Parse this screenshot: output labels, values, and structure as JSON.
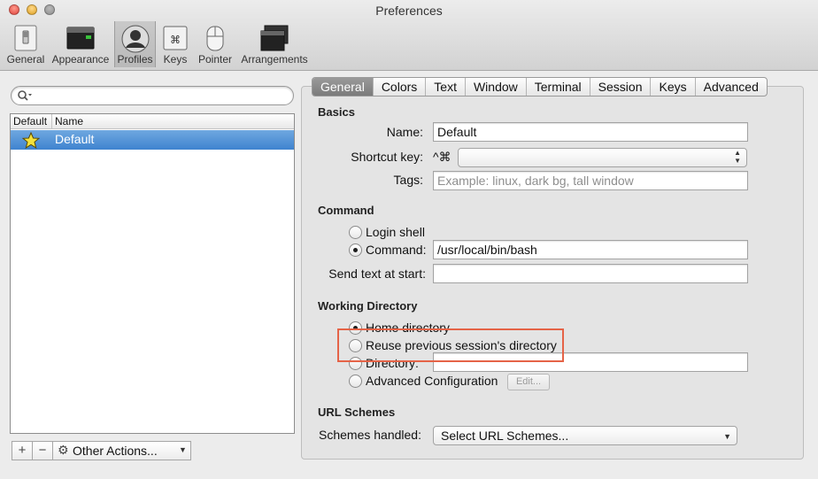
{
  "window": {
    "title": "Preferences"
  },
  "toolbar": {
    "items": [
      {
        "label": "General",
        "icon": "general-switch-icon"
      },
      {
        "label": "Appearance",
        "icon": "appearance-screen-icon"
      },
      {
        "label": "Profiles",
        "icon": "profile-person-icon",
        "selected": true
      },
      {
        "label": "Keys",
        "icon": "command-key-icon"
      },
      {
        "label": "Pointer",
        "icon": "mouse-pointer-icon"
      },
      {
        "label": "Arrangements",
        "icon": "window-arrangements-icon"
      }
    ]
  },
  "left": {
    "search_placeholder": "",
    "columns": {
      "default": "Default",
      "name": "Name"
    },
    "profiles": [
      {
        "name": "Default",
        "is_default": true,
        "selected": true
      }
    ],
    "add_label": "+",
    "remove_label": "−",
    "other_actions_label": "Other Actions..."
  },
  "tabs": [
    {
      "label": "General",
      "selected": true
    },
    {
      "label": "Colors"
    },
    {
      "label": "Text"
    },
    {
      "label": "Window"
    },
    {
      "label": "Terminal"
    },
    {
      "label": "Session"
    },
    {
      "label": "Keys"
    },
    {
      "label": "Advanced"
    }
  ],
  "basics": {
    "heading": "Basics",
    "name_label": "Name:",
    "name_value": "Default",
    "shortcut_label": "Shortcut key:",
    "shortcut_prefix": "^⌘",
    "shortcut_value": "",
    "tags_label": "Tags:",
    "tags_placeholder": "Example: linux, dark bg, tall window"
  },
  "command": {
    "heading": "Command",
    "login_shell_label": "Login shell",
    "command_label": "Command:",
    "command_value": "/usr/local/bin/bash",
    "selected": "command",
    "send_text_label": "Send text at start:",
    "send_text_value": ""
  },
  "working_directory": {
    "heading": "Working Directory",
    "home_label": "Home directory",
    "reuse_label": "Reuse previous session's directory",
    "directory_label": "Directory:",
    "directory_value": "",
    "advanced_label": "Advanced Configuration",
    "edit_label": "Edit...",
    "selected": "home"
  },
  "url_schemes": {
    "heading": "URL Schemes",
    "schemes_label": "Schemes handled:",
    "select_value": "Select URL Schemes..."
  },
  "colors": {
    "selection": "#3f83cf",
    "highlight_box": "#e56347"
  }
}
